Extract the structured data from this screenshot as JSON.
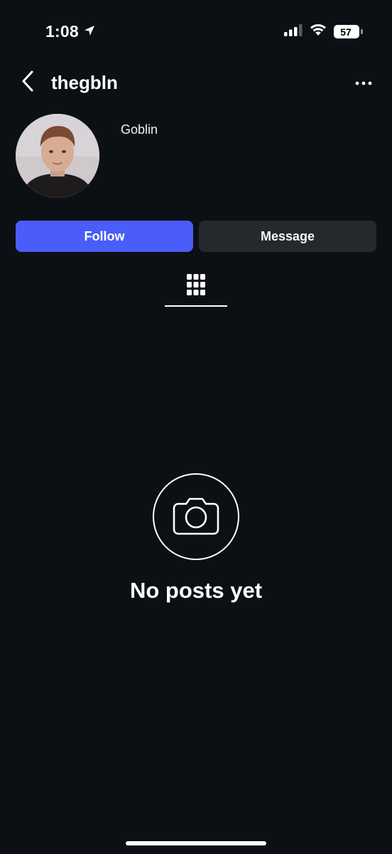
{
  "status_bar": {
    "time": "1:08",
    "battery_level": "57",
    "icons": [
      "location-arrow-icon",
      "cellular-signal-icon",
      "wifi-icon",
      "battery-icon"
    ]
  },
  "nav": {
    "username": "thegbln",
    "back_icon": "chevron-left-icon",
    "more_icon": "more-horizontal-icon"
  },
  "profile": {
    "display_name": "Goblin",
    "avatar_icon": "profile-photo"
  },
  "actions": {
    "follow_label": "Follow",
    "message_label": "Message",
    "follow_color": "#4a5df9",
    "message_color": "#25292e"
  },
  "tabs": {
    "active_icon": "grid-icon"
  },
  "empty_state": {
    "icon": "camera-icon",
    "text": "No posts yet"
  },
  "colors": {
    "background": "#0c1014",
    "text": "#ffffff"
  }
}
